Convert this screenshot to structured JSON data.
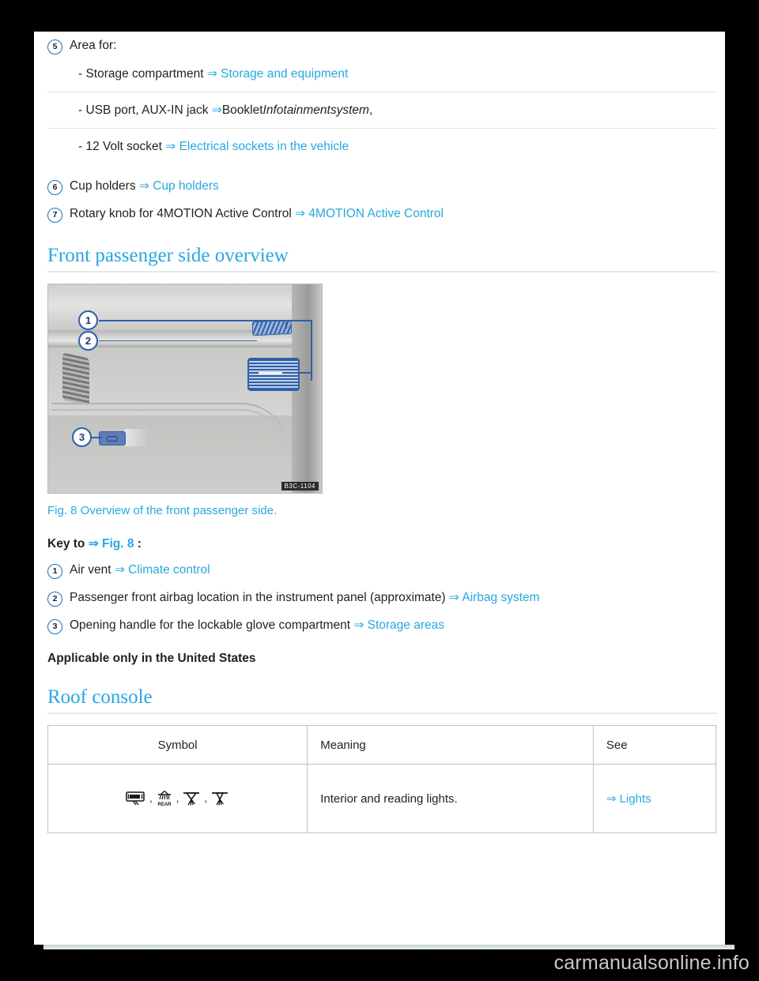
{
  "key_items_top": [
    {
      "number": "5",
      "label": "Area for:",
      "subitems": [
        {
          "text": "- Storage compartment ",
          "arrow": "⇒",
          "link": " Storage and equipment",
          "tail": ""
        },
        {
          "text": "- USB port, AUX-IN jack ",
          "arrow": "⇒",
          "link": "",
          "plain_after": "Booklet",
          "italic": "Infotainmentsystem",
          "tail": ","
        },
        {
          "text": "- 12 Volt socket ",
          "arrow": "⇒",
          "link": " Electrical sockets in the vehicle",
          "tail": ""
        }
      ]
    },
    {
      "number": "6",
      "label": "Cup holders ",
      "arrow": "⇒",
      "link": " Cup holders"
    },
    {
      "number": "7",
      "label": "Rotary knob for 4MOTION Active Control ",
      "arrow": "⇒",
      "link": " 4MOTION Active Control"
    }
  ],
  "section_front_passenger": {
    "heading": "Front passenger side overview",
    "figure": {
      "image_id": "B3C-1104",
      "callouts": [
        "1",
        "2",
        "3"
      ],
      "caption": "Fig. 8 Overview of the front passenger side."
    },
    "key_to_prefix": "Key to ",
    "key_to_arrow": "⇒",
    "key_to_link": " Fig. 8 ",
    "key_to_suffix": ":",
    "key_items": [
      {
        "number": "1",
        "label": "Air vent ",
        "arrow": "⇒",
        "link": " Climate control"
      },
      {
        "number": "2",
        "label": "Passenger front airbag location in the instrument panel (approximate) ",
        "arrow": "⇒",
        "link": " Airbag system"
      },
      {
        "number": "3",
        "label": "Opening handle for the lockable glove compartment ",
        "arrow": "⇒",
        "link": " Storage areas"
      }
    ],
    "notice": "Applicable only in the United States"
  },
  "section_roof_console": {
    "heading": "Roof console",
    "table": {
      "headers": [
        "Symbol",
        "Meaning",
        "See"
      ],
      "rows": [
        {
          "symbols": [
            "interior-light-icon",
            "rear-light-icon",
            "reading-light-left-icon",
            "reading-light-right-icon"
          ],
          "symbol_rear_label": "REAR",
          "meaning": "Interior and reading lights.",
          "see_arrow": "⇒",
          "see_link": " Lights"
        }
      ]
    }
  },
  "watermark": "carmanualsonline.info",
  "colors": {
    "link": "#28a8e0",
    "text": "#231f20",
    "callout_border": "#1a6fb5",
    "table_border": "#b6c4cc",
    "page_bg": "#ffffff",
    "backdrop": "#000000"
  }
}
